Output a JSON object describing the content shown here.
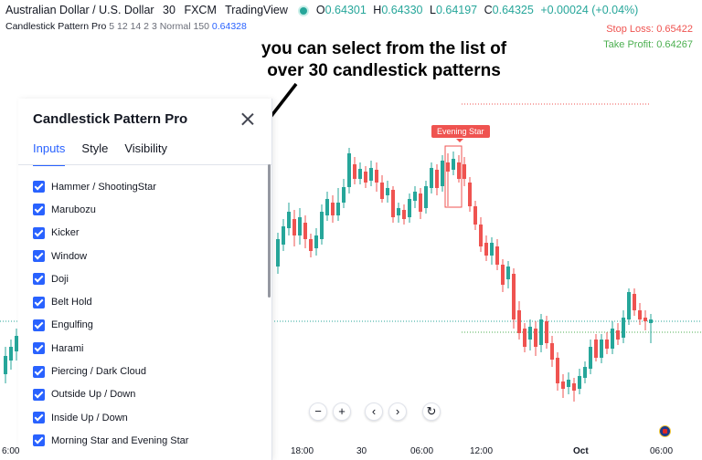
{
  "header": {
    "symbol": "Australian Dollar / U.S. Dollar",
    "interval": "30",
    "exchange": "FXCM",
    "source": "TradingView",
    "open_label": "O",
    "open": "0.64301",
    "high_label": "H",
    "high": "0.64330",
    "low_label": "L",
    "low": "0.64197",
    "close_label": "C",
    "close": "0.64325",
    "change": "+0.00024 (+0.04%)"
  },
  "indicator": {
    "name": "Candlestick Pattern Pro",
    "params": "5 12 14 2 3 Normal 150",
    "last_value": "0.64328"
  },
  "levels": {
    "stop_loss": "Stop Loss: 0.65422",
    "take_profit": "Take Profit: 0.64267"
  },
  "annotation": "you can select from the list of over 30 candlestick patterns",
  "panel": {
    "title": "Candlestick Pattern Pro",
    "tabs": [
      {
        "label": "Inputs",
        "active": true
      },
      {
        "label": "Style",
        "active": false
      },
      {
        "label": "Visibility",
        "active": false
      }
    ],
    "items": [
      {
        "label": "Hammer / ShootingStar",
        "checked": true
      },
      {
        "label": "Marubozu",
        "checked": true
      },
      {
        "label": "Kicker",
        "checked": true
      },
      {
        "label": "Window",
        "checked": true
      },
      {
        "label": "Doji",
        "checked": true
      },
      {
        "label": "Belt Hold",
        "checked": true
      },
      {
        "label": "Engulfing",
        "checked": true
      },
      {
        "label": "Harami",
        "checked": true
      },
      {
        "label": "Piercing / Dark Cloud",
        "checked": true
      },
      {
        "label": "Outside Up / Down",
        "checked": true
      },
      {
        "label": "Inside Up / Down",
        "checked": true
      },
      {
        "label": "Morning Star and Evening Star",
        "checked": true
      }
    ]
  },
  "pattern_label": "Evening Star",
  "controls": {
    "zoom_out": "−",
    "zoom_in": "+",
    "scroll_left": "‹",
    "scroll_right": "›",
    "reset": "↻"
  },
  "time_axis": [
    {
      "label": "6:00",
      "bold": false
    },
    {
      "label": "18:00",
      "bold": false
    },
    {
      "label": "30",
      "bold": false
    },
    {
      "label": "06:00",
      "bold": false
    },
    {
      "label": "12:00",
      "bold": false
    },
    {
      "label": "Oct",
      "bold": true
    },
    {
      "label": "06:00",
      "bold": false
    }
  ],
  "colors": {
    "up": "#26a69a",
    "down": "#ef5350",
    "accent": "#2962ff",
    "stop_loss": "#ef5350",
    "take_profit": "#4caf50"
  }
}
